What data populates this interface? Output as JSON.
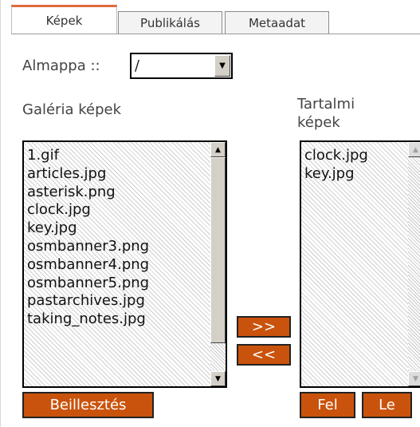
{
  "tabs": [
    "Képek",
    "Publikálás",
    "Metaadat"
  ],
  "folder": {
    "label": "Almappa ::",
    "selected": "/"
  },
  "gallery": {
    "label": "Galéria képek",
    "items": [
      "1.gif",
      "articles.jpg",
      "asterisk.png",
      "clock.jpg",
      "key.jpg",
      "osmbanner3.png",
      "osmbanner4.png",
      "osmbanner5.png",
      "pastarchives.jpg",
      "taking_notes.jpg"
    ]
  },
  "content": {
    "label_line1": "Tartalmi",
    "label_line2": "képek",
    "items": [
      "clock.jpg",
      "key.jpg"
    ]
  },
  "buttons": {
    "add": ">>",
    "remove": "<<",
    "insert": "Beillesztés",
    "up": "Fel",
    "down": "Le"
  },
  "colors": {
    "button_bg": "#c9530c",
    "active_tab_accent": "#e06a3d"
  },
  "icons": {
    "up": "arrow-up-icon",
    "down": "arrow-down-icon"
  }
}
